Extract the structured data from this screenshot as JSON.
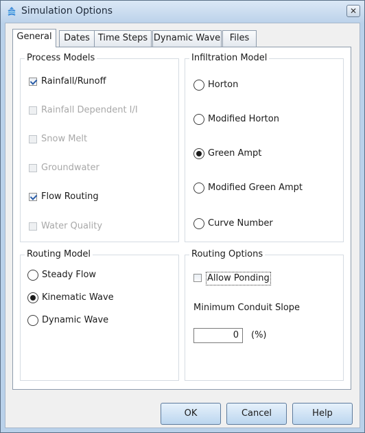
{
  "window": {
    "title": "Simulation Options",
    "close_symbol": "✕"
  },
  "tabs": [
    {
      "label": "General",
      "active": true
    },
    {
      "label": "Dates",
      "active": false
    },
    {
      "label": "Time Steps",
      "active": false
    },
    {
      "label": "Dynamic Wave",
      "active": false
    },
    {
      "label": "Files",
      "active": false
    }
  ],
  "process_models": {
    "title": "Process Models",
    "items": [
      {
        "label": "Rainfall/Runoff",
        "checked": true,
        "enabled": true
      },
      {
        "label": "Rainfall Dependent I/I",
        "checked": false,
        "enabled": false
      },
      {
        "label": "Snow Melt",
        "checked": false,
        "enabled": false
      },
      {
        "label": "Groundwater",
        "checked": false,
        "enabled": false
      },
      {
        "label": "Flow Routing",
        "checked": true,
        "enabled": true
      },
      {
        "label": "Water Quality",
        "checked": false,
        "enabled": false
      }
    ]
  },
  "infiltration_model": {
    "title": "Infiltration Model",
    "options": [
      {
        "label": "Horton",
        "selected": false
      },
      {
        "label": "Modified Horton",
        "selected": false
      },
      {
        "label": "Green Ampt",
        "selected": true
      },
      {
        "label": "Modified Green Ampt",
        "selected": false
      },
      {
        "label": "Curve Number",
        "selected": false
      }
    ]
  },
  "routing_model": {
    "title": "Routing Model",
    "options": [
      {
        "label": "Steady Flow",
        "selected": false
      },
      {
        "label": "Kinematic Wave",
        "selected": true
      },
      {
        "label": "Dynamic Wave",
        "selected": false
      }
    ]
  },
  "routing_options": {
    "title": "Routing Options",
    "allow_ponding_label": "Allow Ponding",
    "allow_ponding_checked": false,
    "min_slope_label": "Minimum Conduit Slope",
    "min_slope_value": "0",
    "min_slope_unit": "(%)"
  },
  "buttons": {
    "ok": "OK",
    "cancel": "Cancel",
    "help": "Help"
  }
}
